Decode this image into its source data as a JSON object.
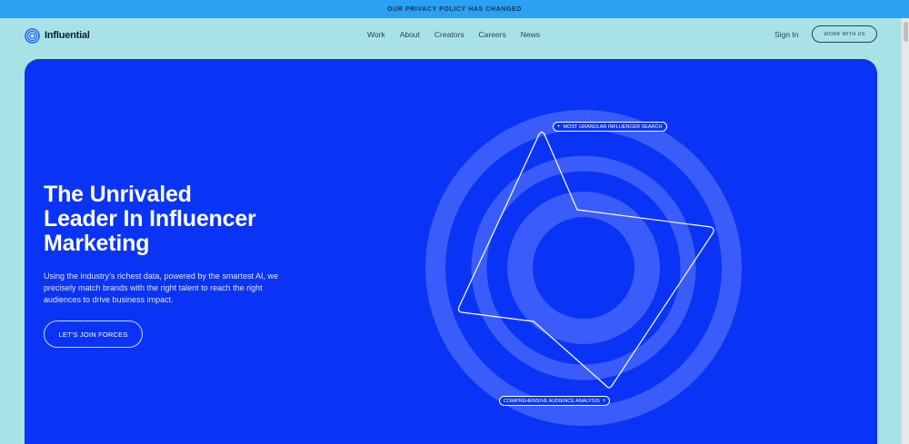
{
  "banner": {
    "text": "OUR PRIVACY POLICY HAS CHANGED"
  },
  "nav": {
    "logo_text": "Influential",
    "links": [
      "Work",
      "About",
      "Creators",
      "Careers",
      "News"
    ],
    "sign_in": "Sign In",
    "cta": "WORK WITH US"
  },
  "hero": {
    "title_lines": [
      "The Unrivaled",
      "Leader In Influencer",
      "Marketing"
    ],
    "description": "Using the industry’s richest data, powered by the smartest AI, we precisely match brands with the right talent to reach the right audiences to drive business impact.",
    "cta": "LET'S JOIN FORCES",
    "tags": {
      "top": "MOST GRANULAR INFLUENCER SEARCH",
      "bottom": "COMPREHENSIVE AUDIENCE ANALYSIS"
    }
  },
  "colors": {
    "page_bg": "#a8e2e6",
    "banner_bg": "#2aa1f2",
    "hero_bg": "#0a34f5",
    "ring": "#3a5cfa"
  },
  "icons": {
    "logo": "concentric-circles-icon",
    "tag_marker": "plus-icon",
    "scroll": "scrollbar"
  }
}
